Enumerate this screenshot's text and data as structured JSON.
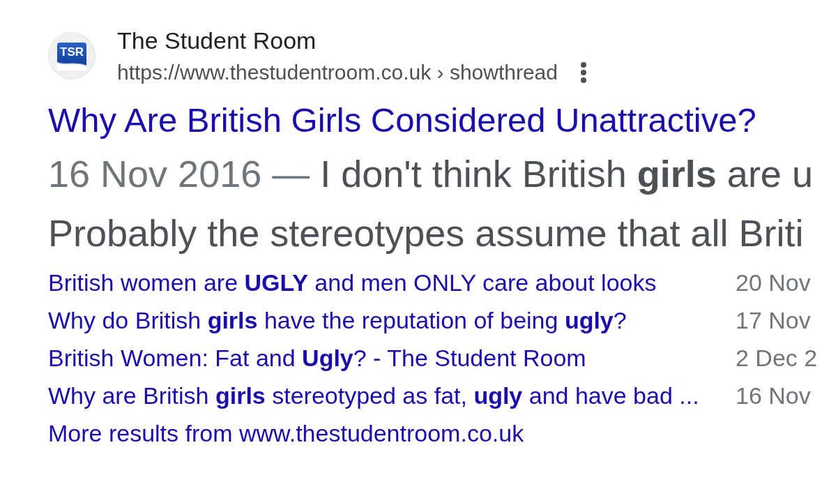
{
  "result": {
    "favicon": {
      "text": "TSR"
    },
    "site_name": "The Student Room",
    "url": "https://www.thestudentroom.co.uk › showthread",
    "title": "Why Are British Girls Considered Unattractive?",
    "snippet": {
      "date": "16 Nov 2016",
      "separator": "—",
      "lines": [
        "I don't think British **girls** are u",
        "Probably the stereotypes assume that all Briti"
      ]
    },
    "sitelinks": [
      {
        "title": "British women are **UGLY** and men ONLY care about looks",
        "date": "20 Nov"
      },
      {
        "title": "Why do British **girls** have the reputation of being **ugly**?",
        "date": "17 Nov"
      },
      {
        "title": "British Women: Fat and **Ugly**? - The Student Room",
        "date": "2 Dec 2"
      },
      {
        "title": "Why are British **girls** stereotyped as fat, **ugly** and have bad ...",
        "date": "16 Nov"
      }
    ],
    "more_results": "More results from www.thestudentroom.co.uk"
  }
}
